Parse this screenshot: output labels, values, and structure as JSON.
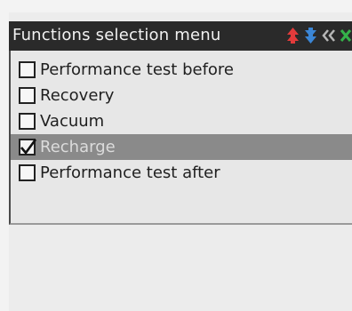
{
  "window": {
    "title": "Functions selection menu",
    "icons": [
      "up-arrows-icon",
      "down-arrows-icon",
      "back-double-chevron-icon",
      "close-icon"
    ],
    "colors": {
      "title_bg": "#2a2a2a",
      "up_arrow": "#e23b3b",
      "down_arrow": "#3b86d6",
      "chevron": "#b7b7b7",
      "close": "#35b34a",
      "selected_row": "#8a8a8a"
    }
  },
  "menu": {
    "items": [
      {
        "label": "Performance test before",
        "checked": false,
        "selected": false
      },
      {
        "label": "Recovery",
        "checked": false,
        "selected": false
      },
      {
        "label": "Vacuum",
        "checked": false,
        "selected": false
      },
      {
        "label": "Recharge",
        "checked": true,
        "selected": true
      },
      {
        "label": "Performance test after",
        "checked": false,
        "selected": false
      }
    ]
  }
}
